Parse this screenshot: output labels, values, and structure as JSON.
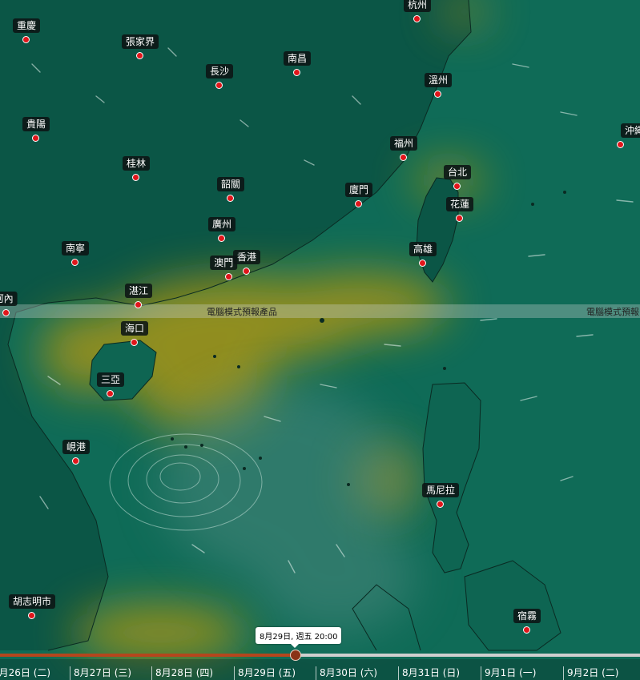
{
  "colors": {
    "sea": "#0f6b57",
    "land": "#0b5444",
    "heat": "#a79416",
    "marker": "#e0161b",
    "timeline_played": "#b5461d"
  },
  "banner_text": "電腦模式預報產品",
  "banner_text_right": "電腦模式預報",
  "cities": [
    {
      "name": "杭州"
    },
    {
      "name": "重慶"
    },
    {
      "name": "張家界"
    },
    {
      "name": "南昌"
    },
    {
      "name": "長沙"
    },
    {
      "name": "溫州"
    },
    {
      "name": "貴陽"
    },
    {
      "name": "沖繩"
    },
    {
      "name": "福州"
    },
    {
      "name": "桂林"
    },
    {
      "name": "台北"
    },
    {
      "name": "韶關"
    },
    {
      "name": "廈門"
    },
    {
      "name": "花蓮"
    },
    {
      "name": "廣州"
    },
    {
      "name": "南寧"
    },
    {
      "name": "高雄"
    },
    {
      "name": "香港"
    },
    {
      "name": "澳門"
    },
    {
      "name": "湛江"
    },
    {
      "name": "河內"
    },
    {
      "name": "海口"
    },
    {
      "name": "三亞"
    },
    {
      "name": "峴港"
    },
    {
      "name": "馬尼拉"
    },
    {
      "name": "胡志明市"
    },
    {
      "name": "宿霧"
    }
  ],
  "timeline": {
    "tooltip": "8月29日, 週五 20:00",
    "days": [
      "8月26日 (二)",
      "8月27日 (三)",
      "8月28日 (四)",
      "8月29日 (五)",
      "8月30日 (六)",
      "8月31日 (日)",
      "9月1日 (一)",
      "9月2日 (二)"
    ]
  }
}
